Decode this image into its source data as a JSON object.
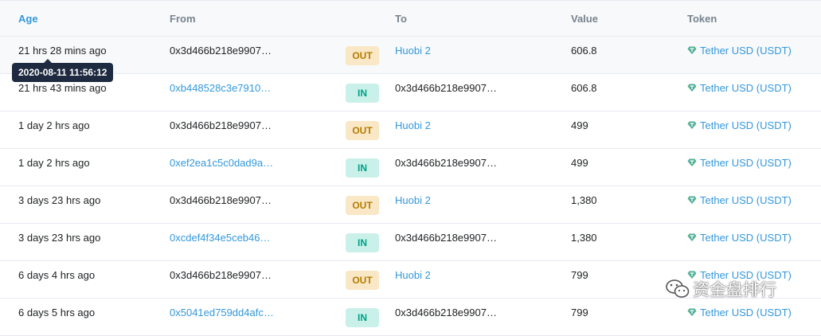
{
  "header": {
    "age": "Age",
    "from": "From",
    "to": "To",
    "value": "Value",
    "token": "Token"
  },
  "tooltip": "2020-08-11 11:56:12",
  "token_icon": "tether-diamond-icon",
  "colors": {
    "link": "#3498db",
    "out_bg": "#f9e7c5",
    "out_text": "#b47d00",
    "in_bg": "#c9f1e9",
    "in_text": "#00a186",
    "token_icon": "#50af95"
  },
  "rows": [
    {
      "age": "21 hrs 28 mins ago",
      "from": "0x3d466b218e9907…",
      "dir": "OUT",
      "to": "Huobi 2",
      "value": "606.8",
      "token": "Tether USD (USDT)"
    },
    {
      "age": "21 hrs 43 mins ago",
      "from": "0xb448528c3e7910…",
      "dir": "IN",
      "to": "0x3d466b218e9907…",
      "value": "606.8",
      "token": "Tether USD (USDT)"
    },
    {
      "age": "1 day 2 hrs ago",
      "from": "0x3d466b218e9907…",
      "dir": "OUT",
      "to": "Huobi 2",
      "value": "499",
      "token": "Tether USD (USDT)"
    },
    {
      "age": "1 day 2 hrs ago",
      "from": "0xef2ea1c5c0dad9a…",
      "dir": "IN",
      "to": "0x3d466b218e9907…",
      "value": "499",
      "token": "Tether USD (USDT)"
    },
    {
      "age": "3 days 23 hrs ago",
      "from": "0x3d466b218e9907…",
      "dir": "OUT",
      "to": "Huobi 2",
      "value": "1,380",
      "token": "Tether USD (USDT)"
    },
    {
      "age": "3 days 23 hrs ago",
      "from": "0xcdef4f34e5ceb46…",
      "dir": "IN",
      "to": "0x3d466b218e9907…",
      "value": "1,380",
      "token": "Tether USD (USDT)"
    },
    {
      "age": "6 days 4 hrs ago",
      "from": "0x3d466b218e9907…",
      "dir": "OUT",
      "to": "Huobi 2",
      "value": "799",
      "token": "Tether USD (USDT)"
    },
    {
      "age": "6 days 5 hrs ago",
      "from": "0x5041ed759dd4afc…",
      "dir": "IN",
      "to": "0x3d466b218e9907…",
      "value": "799",
      "token": "Tether USD (USDT)"
    }
  ],
  "watermark": "资金盘排行"
}
